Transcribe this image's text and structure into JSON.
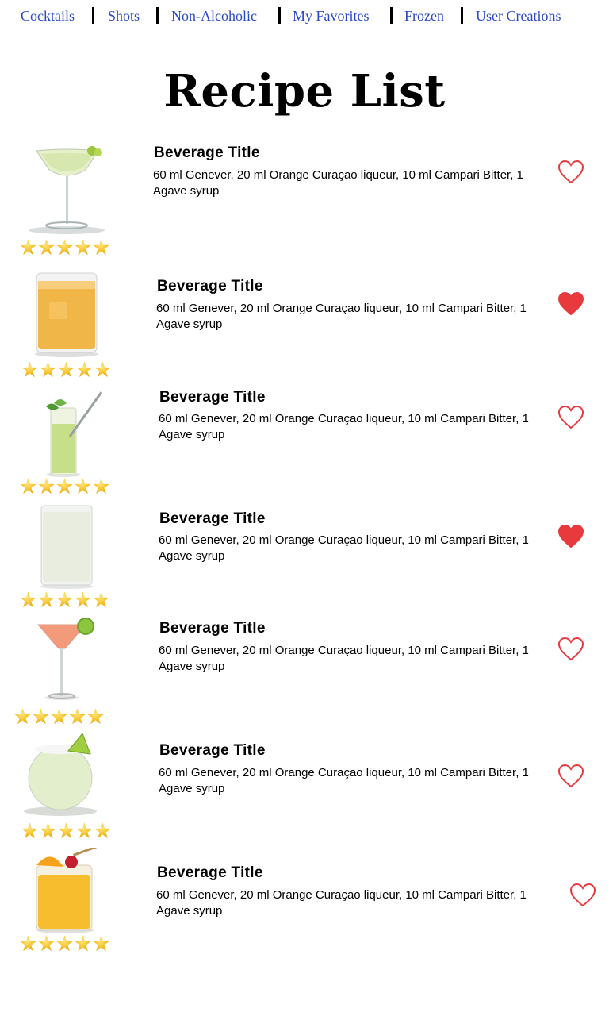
{
  "nav": {
    "items": [
      "Cocktails",
      "Shots",
      "Non-Alcoholic",
      "My Favorites",
      "Frozen",
      "User Creations"
    ]
  },
  "page": {
    "title": "Recipe List"
  },
  "accent_color": "#e8393c",
  "link_color": "#2a49c6",
  "recipes": [
    {
      "title": "Beverage Title",
      "ingredients": "60 ml Genever, 20 ml Orange Curaçao liqueur, 10 ml Campari Bitter, 1 Agave syrup",
      "rating": 5,
      "favorite": false,
      "image": "margarita-glass-icon"
    },
    {
      "title": "Beverage Title",
      "ingredients": "60 ml Genever, 20 ml Orange Curaçao liqueur, 10 ml Campari Bitter, 1 Agave syrup",
      "rating": 5,
      "favorite": true,
      "image": "whiskey-sour-glass-icon"
    },
    {
      "title": "Beverage Title",
      "ingredients": "60 ml Genever, 20 ml Orange Curaçao liqueur, 10 ml Campari Bitter, 1 Agave syrup",
      "rating": 5,
      "favorite": false,
      "image": "mojito-glass-icon"
    },
    {
      "title": "Beverage Title",
      "ingredients": "60 ml Genever, 20 ml Orange Curaçao liqueur, 10 ml Campari Bitter, 1 Agave syrup",
      "rating": 5,
      "favorite": true,
      "image": "highball-glass-icon"
    },
    {
      "title": "Beverage Title",
      "ingredients": "60 ml Genever, 20 ml Orange Curaçao liqueur, 10 ml Campari Bitter, 1 Agave syrup",
      "rating": 5,
      "favorite": false,
      "image": "cosmopolitan-glass-icon"
    },
    {
      "title": "Beverage Title",
      "ingredients": "60 ml Genever, 20 ml Orange Curaçao liqueur, 10 ml Campari Bitter, 1 Agave syrup",
      "rating": 5,
      "favorite": false,
      "image": "margarita-bowl-glass-icon"
    },
    {
      "title": "Beverage Title",
      "ingredients": "60 ml Genever, 20 ml Orange Curaçao liqueur, 10 ml Campari Bitter, 1 Agave syrup",
      "rating": 5,
      "favorite": false,
      "image": "tiki-glass-icon"
    }
  ]
}
